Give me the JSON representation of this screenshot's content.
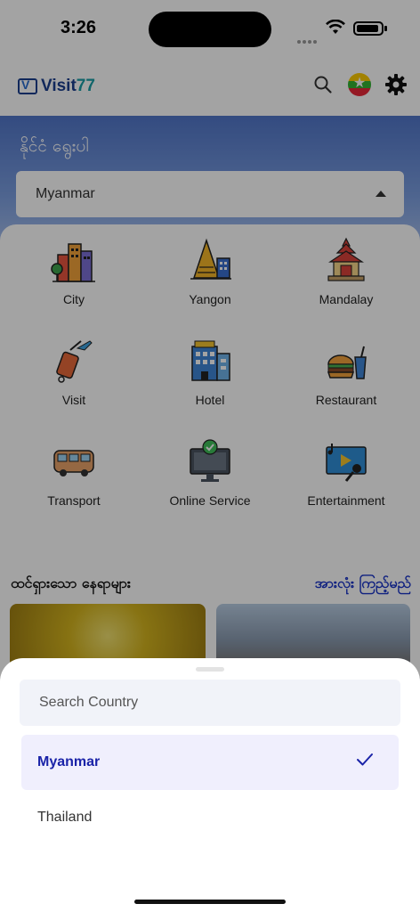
{
  "status_bar": {
    "time": "3:26"
  },
  "header": {
    "logo_text": "Visit",
    "logo_num": "77",
    "search_icon": "search-icon",
    "flag_icon": "myanmar-flag-icon",
    "settings_icon": "gear-icon"
  },
  "hero": {
    "title": "နိုင်ငံ ရွေးပါ",
    "selected_country": "Myanmar"
  },
  "categories": [
    {
      "label": "City",
      "icon": "city-buildings-icon"
    },
    {
      "label": "Yangon",
      "icon": "pagoda-icon"
    },
    {
      "label": "Mandalay",
      "icon": "palace-icon"
    },
    {
      "label": "Visit",
      "icon": "luggage-plane-icon"
    },
    {
      "label": "Hotel",
      "icon": "hotel-building-icon"
    },
    {
      "label": "Restaurant",
      "icon": "burger-drink-icon"
    },
    {
      "label": "Transport",
      "icon": "bus-icon"
    },
    {
      "label": "Online Service",
      "icon": "monitor-check-icon"
    },
    {
      "label": "Entertainment",
      "icon": "music-video-icon"
    }
  ],
  "section": {
    "title": "ထင်ရှားသော နေရာများ",
    "see_all": "အားလုံး ကြည့်မည်"
  },
  "sheet": {
    "search_placeholder": "Search Country",
    "options": [
      {
        "label": "Myanmar",
        "selected": true
      },
      {
        "label": "Thailand",
        "selected": false
      }
    ]
  },
  "colors": {
    "accent": "#1a35c8",
    "selected_option_bg": "#f0effd",
    "selected_option_text": "#1a23a8",
    "hero_blue": "#5176c9"
  }
}
